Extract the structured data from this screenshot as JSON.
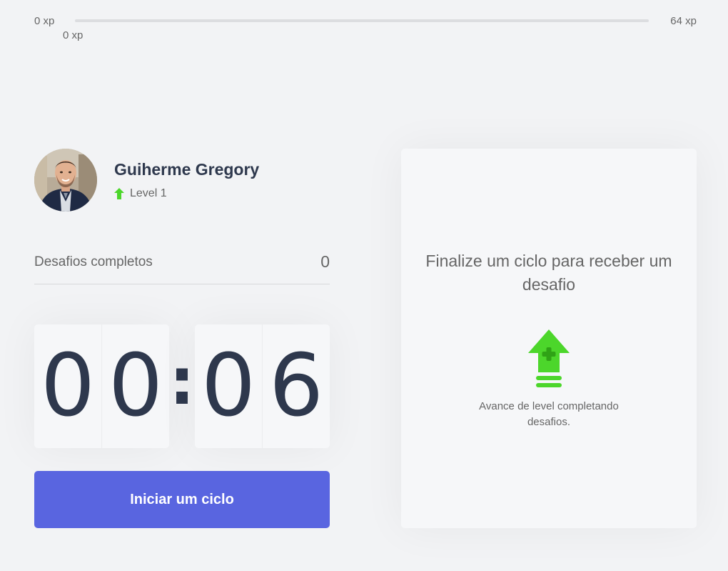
{
  "xp": {
    "min_label": "0 xp",
    "max_label": "64 xp",
    "current_label": "0 xp",
    "progress_fraction": 0
  },
  "profile": {
    "name": "Guiherme Gregory",
    "level_label": "Level 1"
  },
  "completed_challenges": {
    "label": "Desafios completos",
    "value": "0"
  },
  "countdown": {
    "minute_left": "0",
    "minute_right": "0",
    "separator": ":",
    "second_left": "0",
    "second_right": "6"
  },
  "start_button": {
    "label": "Iniciar um ciclo"
  },
  "challenge_box": {
    "title": "Finalize um ciclo para receber um desafio",
    "description": "Avance de level completando desafios."
  },
  "colors": {
    "accent_green": "#4cd62b",
    "button_blue": "#5965e0",
    "title_dark": "#2e384d",
    "text_gray": "#666666",
    "background": "#f2f3f5"
  },
  "icons": {
    "level": "level-up-arrow-icon",
    "challenge": "level-up-arrow-plus-icon"
  }
}
